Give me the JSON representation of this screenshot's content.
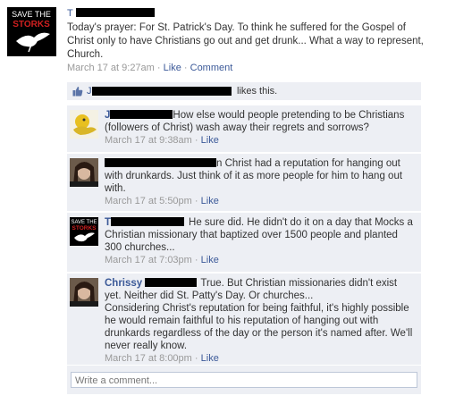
{
  "post": {
    "author_initial": "T",
    "text": "Today's prayer: For St. Patrick's Day. To think he suffered for the Gospel of Christ only to have Christians go out and get drunk... What a way to represent, Church.",
    "timestamp": "March 17 at 9:27am",
    "like_label": "Like",
    "comment_label": "Comment",
    "avatar_text": [
      "SAVE THE",
      "STORKS"
    ]
  },
  "likes": {
    "name_initial": "J",
    "text": "likes this."
  },
  "comments": [
    {
      "author_initial": "J",
      "text": "How else would people pretending to be Christians (followers of Christ) wash away their regrets and sorrows?",
      "timestamp": "March 17 at 9:38am",
      "like_label": "Like"
    },
    {
      "author_initial": "",
      "text_suffix": "n Christ had a reputation for hanging out with drunkards. Just think of it as more people for him to hang out with.",
      "timestamp": "March 17 at 5:50pm",
      "like_label": "Like"
    },
    {
      "author_initial": "T",
      "text": "He sure did. He didn't do it on a day that Mocks a Christian missionary that baptized over 1500 people and planted 300 churches...",
      "timestamp": "March 17 at 7:03pm",
      "like_label": "Like"
    },
    {
      "author": "Chrissy",
      "text": "True. But Christian missionaries didn't exist yet. Neither did St. Patty's Day. Or churches...",
      "text2": "Considering Christ's reputation for being faithful, it's highly possible he would remain faithful to his reputation of hanging out with drunkards regardless of the day or the person it's named after. We'll never really know.",
      "timestamp": "March 17 at 8:00pm",
      "like_label": "Like"
    }
  ],
  "write_comment": {
    "placeholder": "Write a comment..."
  },
  "separator": "·"
}
